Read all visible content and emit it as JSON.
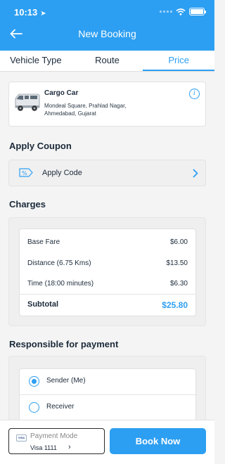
{
  "status_bar": {
    "time": "10:13"
  },
  "header": {
    "title": "New Booking"
  },
  "tabs": [
    {
      "label": "Vehicle Type"
    },
    {
      "label": "Route"
    },
    {
      "label": "Price",
      "active": true
    }
  ],
  "vehicle": {
    "name": "Cargo Car",
    "address_line1": "Mondeal Square, Prahlad Nagar,",
    "address_line2": "Ahmedabad, Gujarat",
    "info_glyph": "i"
  },
  "coupon": {
    "section_title": "Apply Coupon",
    "label": "Apply Code",
    "icon_text": "%"
  },
  "charges": {
    "section_title": "Charges",
    "rows": [
      {
        "label": "Base Fare",
        "amount": "$6.00"
      },
      {
        "label": "Distance (6.75 Kms)",
        "amount": "$13.50"
      },
      {
        "label": "Time (18:00 minutes)",
        "amount": "$6.30"
      }
    ],
    "subtotal": {
      "label": "Subtotal",
      "amount": "$25.80"
    }
  },
  "payer": {
    "section_title": "Responsible for payment",
    "options": [
      {
        "label": "Sender (Me)",
        "selected": true
      },
      {
        "label": "Receiver",
        "selected": false
      }
    ]
  },
  "payment": {
    "title": "Payment Mode",
    "value": "Visa 1111",
    "card_brand": "VISA"
  },
  "actions": {
    "book_label": "Book Now"
  },
  "colors": {
    "accent": "#2d9ff2",
    "text": "#1b2a3a"
  }
}
